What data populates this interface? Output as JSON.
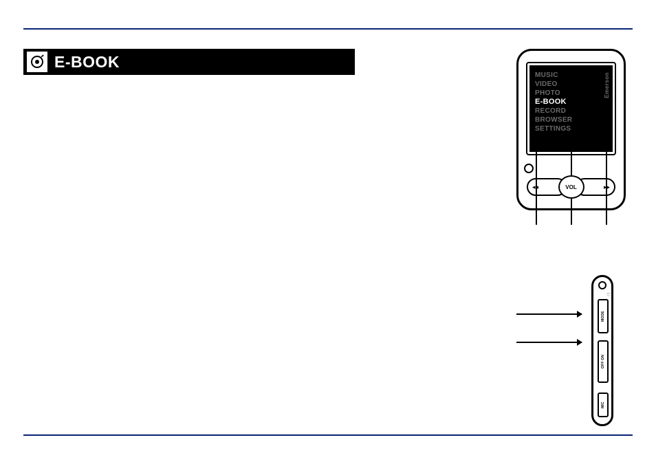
{
  "section_title": "E-BOOK",
  "device_brand": "Emerson",
  "menu_items": [
    {
      "label": "MUSIC",
      "selected": false
    },
    {
      "label": "VIDEO",
      "selected": false
    },
    {
      "label": "PHOTO",
      "selected": false
    },
    {
      "label": "E-BOOK",
      "selected": true
    },
    {
      "label": "RECORD",
      "selected": false
    },
    {
      "label": "BROWSER",
      "selected": false
    },
    {
      "label": "SETTINGS",
      "selected": false
    }
  ],
  "center_button_label": "VOL",
  "left_skip_glyph": "◂◂",
  "right_skip_glyph": "▸▸",
  "side_labels": {
    "top_slot": "MODE",
    "middle_slot": "OFF  ON",
    "bottom_slot": "MIC"
  },
  "side_icons": {
    "heart": "♡",
    "headphone": "🎧"
  }
}
